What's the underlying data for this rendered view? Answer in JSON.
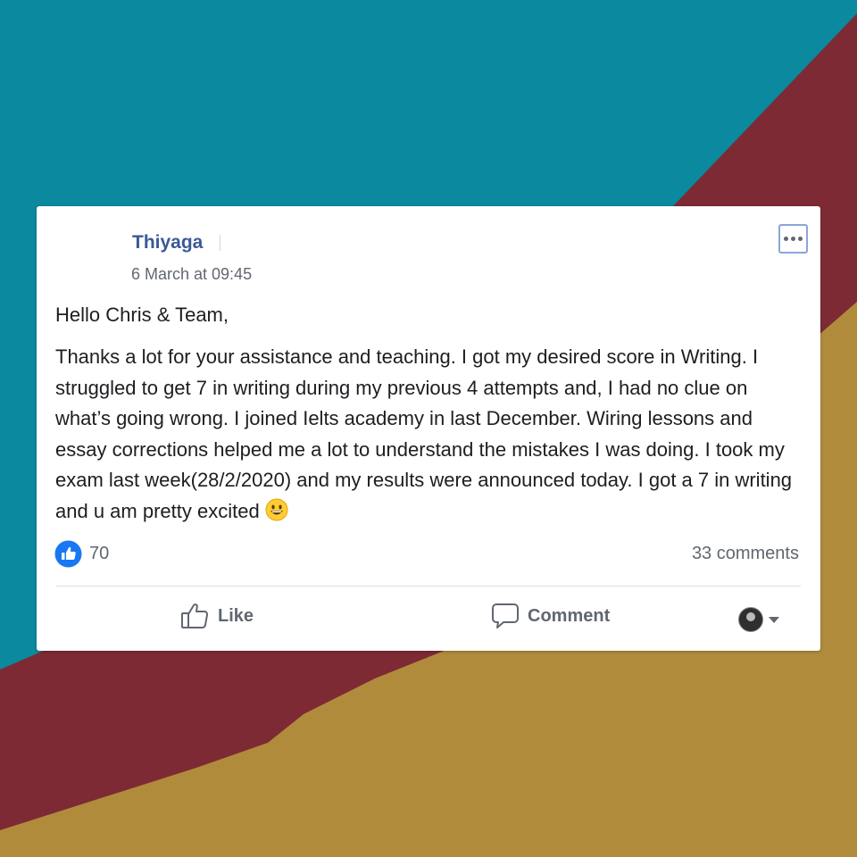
{
  "colors": {
    "background_teal": "#0b899f",
    "background_maroon": "#7d2a34",
    "background_mustard": "#b08b3c",
    "author_link": "#3b5998",
    "like_badge": "#1877f2"
  },
  "post": {
    "author": "Thiyaga",
    "timestamp": "6 March at 09:45",
    "menu_icon": "ellipsis-icon",
    "greeting": "Hello Chris & Team,",
    "body": "Thanks a lot for your assistance and teaching. I got my desired score in Writing. I struggled to get 7 in writing during my previous 4 attempts and, I had no clue on what’s going wrong. I joined Ielts academy in last December. Wiring lessons and essay corrections helped me a lot to understand the mistakes I was doing. I took my exam last week(28/2/2020) and my results were announced today. I got a 7 in writing and u am pretty excited",
    "emoji": "grinning-face-emoji"
  },
  "stats": {
    "like_count": "70",
    "comments": "33 comments"
  },
  "actions": {
    "like_label": "Like",
    "comment_label": "Comment"
  }
}
